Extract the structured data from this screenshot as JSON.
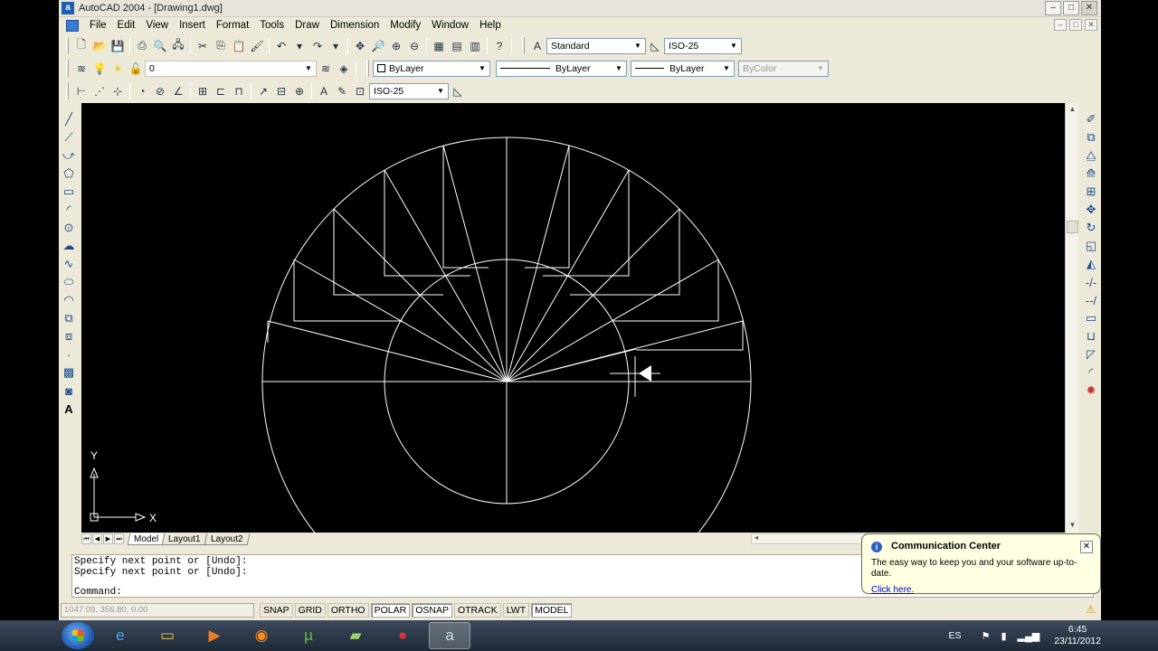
{
  "window": {
    "title": "AutoCAD 2004 - [Drawing1.dwg]",
    "min": "–",
    "max": "□",
    "close": "✕"
  },
  "menu": [
    "File",
    "Edit",
    "View",
    "Insert",
    "Format",
    "Tools",
    "Draw",
    "Dimension",
    "Modify",
    "Window",
    "Help"
  ],
  "toolbar": {
    "text_style": "Standard",
    "dim_style": "ISO-25",
    "layer": "0",
    "color": "ByLayer",
    "linetype": "ByLayer",
    "lineweight": "ByLayer",
    "plot_style": "ByColor",
    "dim_style_2": "ISO-25"
  },
  "ucs": {
    "x_label": "X",
    "y_label": "Y"
  },
  "tabs": [
    "Model",
    "Layout1",
    "Layout2"
  ],
  "command": {
    "history": [
      "Specify next point or [Undo]:",
      "Specify next point or [Undo]:"
    ],
    "prompt": "Command:"
  },
  "status": {
    "coords": "1047.09, 356.80, 0.00",
    "buttons": [
      {
        "label": "SNAP",
        "on": false
      },
      {
        "label": "GRID",
        "on": false
      },
      {
        "label": "ORTHO",
        "on": false
      },
      {
        "label": "POLAR",
        "on": true
      },
      {
        "label": "OSNAP",
        "on": true
      },
      {
        "label": "OTRACK",
        "on": false
      },
      {
        "label": "LWT",
        "on": false
      },
      {
        "label": "MODEL",
        "on": true
      }
    ]
  },
  "balloon": {
    "title": "Communication Center",
    "text": "The easy way to keep you and your software up-to-date.",
    "link": "Click here."
  },
  "taskbar": {
    "lang": "ES",
    "time": "6:45",
    "date": "23/11/2012"
  },
  "colors": {
    "canvas": "#000000",
    "lines": "#ffffff",
    "chrome": "#ece9d8",
    "taskbar": "#1f2a38"
  }
}
